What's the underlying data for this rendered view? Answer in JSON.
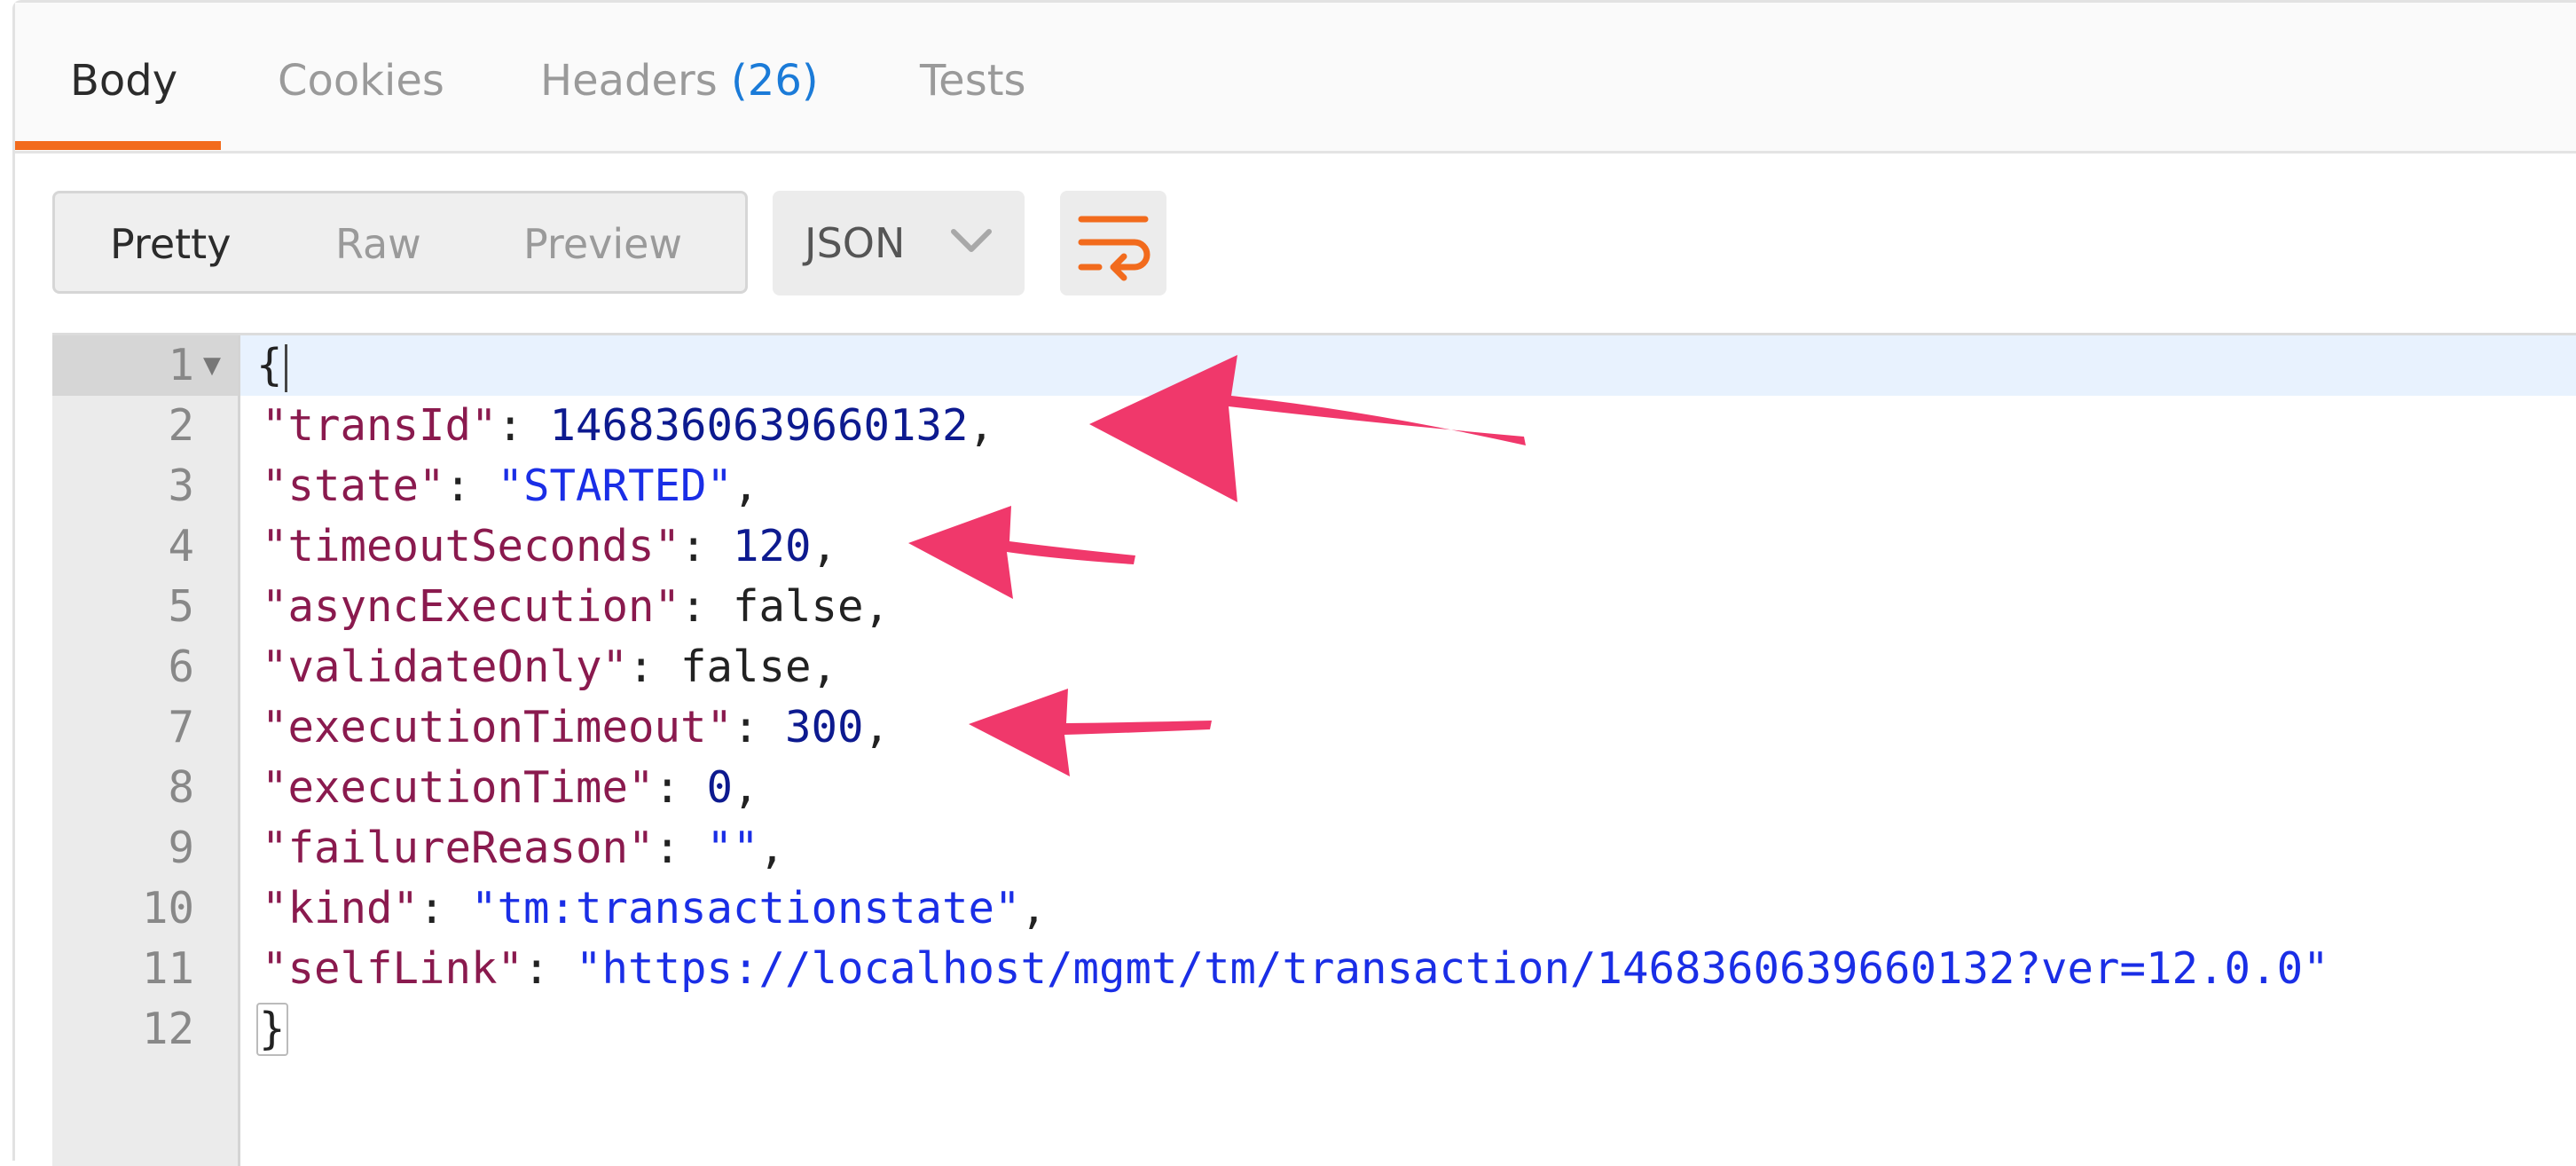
{
  "tabs": [
    {
      "label": "Body"
    },
    {
      "label": "Cookies"
    },
    {
      "label": "Headers",
      "count": "(26)"
    },
    {
      "label": "Tests"
    }
  ],
  "view_modes": [
    "Pretty",
    "Raw",
    "Preview"
  ],
  "format_select": {
    "value": "JSON"
  },
  "code": {
    "line_numbers": [
      "1",
      "2",
      "3",
      "4",
      "5",
      "6",
      "7",
      "8",
      "9",
      "10",
      "11",
      "12"
    ],
    "open_brace": "{",
    "close_brace": "}",
    "lines": [
      {
        "key": "\"transId\"",
        "value": "1468360639660132",
        "type": "num"
      },
      {
        "key": "\"state\"",
        "value": "\"STARTED\"",
        "type": "str"
      },
      {
        "key": "\"timeoutSeconds\"",
        "value": "120",
        "type": "num"
      },
      {
        "key": "\"asyncExecution\"",
        "value": "false",
        "type": "lit"
      },
      {
        "key": "\"validateOnly\"",
        "value": "false",
        "type": "lit"
      },
      {
        "key": "\"executionTimeout\"",
        "value": "300",
        "type": "num"
      },
      {
        "key": "\"executionTime\"",
        "value": "0",
        "type": "num"
      },
      {
        "key": "\"failureReason\"",
        "value": "\"\"",
        "type": "str"
      },
      {
        "key": "\"kind\"",
        "value": "\"tm:transactionstate\"",
        "type": "str"
      },
      {
        "key": "\"selfLink\"",
        "value": "\"https://localhost/mgmt/tm/transaction/1468360639660132?ver=12.0.0\"",
        "type": "str"
      }
    ]
  },
  "colors": {
    "accent": "#f26b1d",
    "annotation": "#f0386b",
    "key": "#8a1a4e",
    "number": "#0d1a8f",
    "string": "#1a2ee6"
  }
}
